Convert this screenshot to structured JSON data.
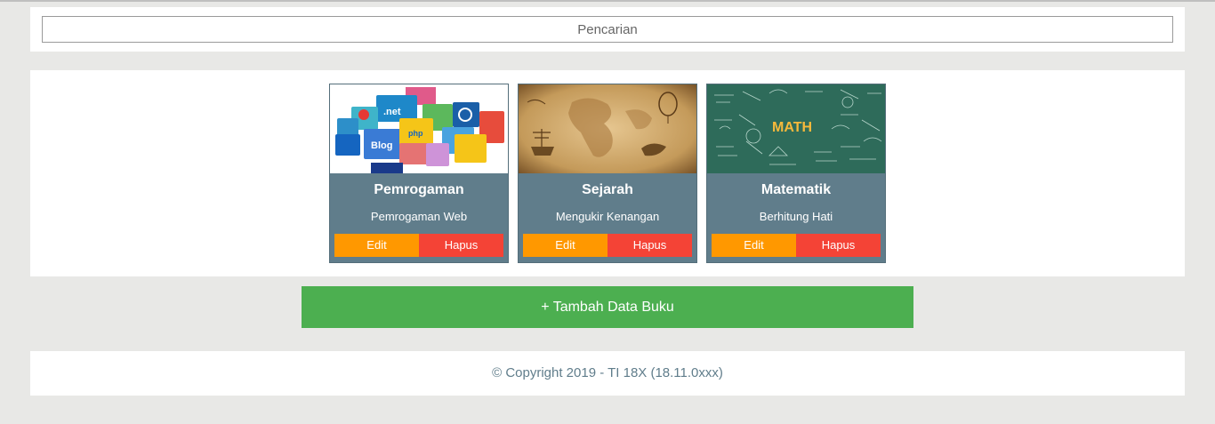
{
  "search": {
    "placeholder": "Pencarian"
  },
  "books": [
    {
      "title": "Pemrogaman",
      "subtitle": "Pemrogaman Web",
      "image": "programming-logos-image",
      "edit_label": "Edit",
      "delete_label": "Hapus"
    },
    {
      "title": "Sejarah",
      "subtitle": "Mengukir Kenangan",
      "image": "antique-map-image",
      "edit_label": "Edit",
      "delete_label": "Hapus"
    },
    {
      "title": "Matematik",
      "subtitle": "Berhitung Hati",
      "image": "math-chalkboard-image",
      "edit_label": "Edit",
      "delete_label": "Hapus",
      "image_text": "MATH"
    }
  ],
  "add_button_label": "+ Tambah Data Buku",
  "footer": {
    "copyright": "© Copyright 2019 - TI 18X (18.11.0xxx)"
  },
  "colors": {
    "card_bg": "#607d8b",
    "edit": "#ff9800",
    "delete": "#f44336",
    "add": "#4caf50",
    "page_bg": "#e8e8e6"
  }
}
